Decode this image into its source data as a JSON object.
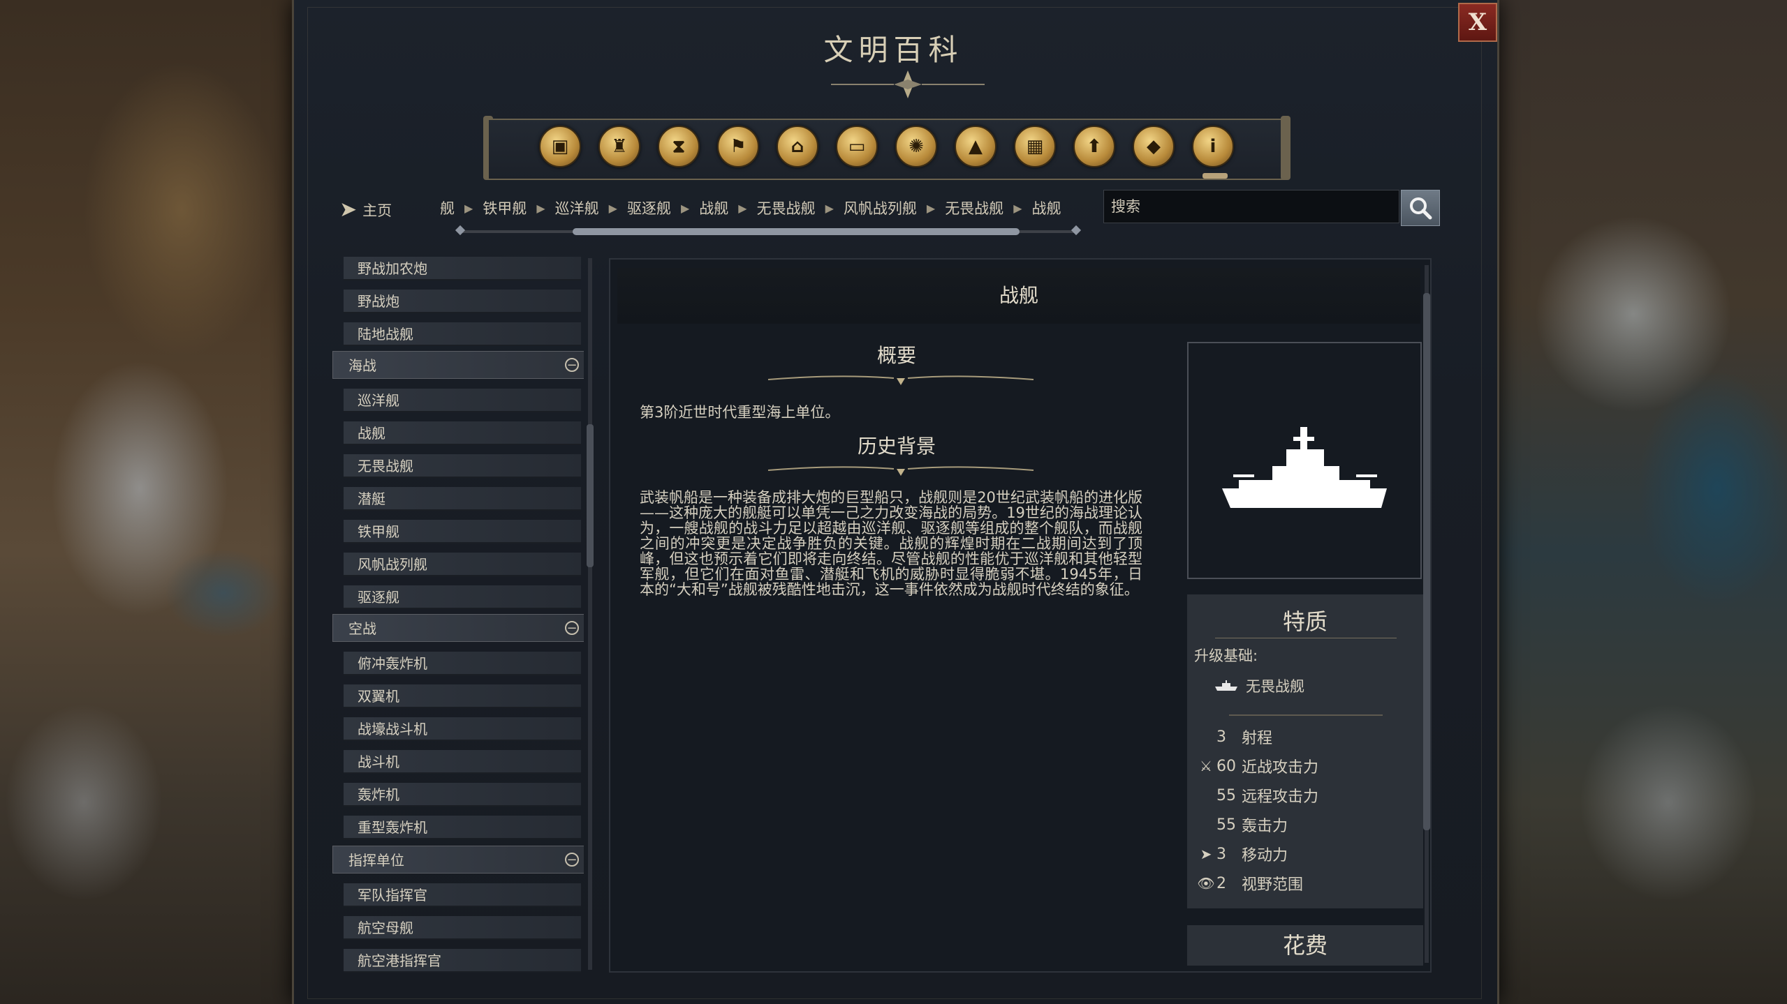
{
  "window": {
    "title": "文明百科",
    "close_label": "X"
  },
  "categories": [
    {
      "icon": "units-icon"
    },
    {
      "icon": "cup-icon"
    },
    {
      "icon": "hourglass-icon"
    },
    {
      "icon": "flag-icon"
    },
    {
      "icon": "building-icon"
    },
    {
      "icon": "book-icon"
    },
    {
      "icon": "atom-icon"
    },
    {
      "icon": "terrain-icon"
    },
    {
      "icon": "city-icon"
    },
    {
      "icon": "upgrade-icon"
    },
    {
      "icon": "resource-icon"
    },
    {
      "icon": "info-icon"
    }
  ],
  "breadcrumb": {
    "home": "主页",
    "items": [
      "舰",
      "铁甲舰",
      "巡洋舰",
      "驱逐舰",
      "战舰",
      "无畏战舰",
      "风帆战列舰",
      "无畏战舰",
      "战舰"
    ]
  },
  "search": {
    "placeholder": "搜索"
  },
  "sidebar": {
    "rows": [
      {
        "type": "item",
        "label": "野战加农炮"
      },
      {
        "type": "item",
        "label": "野战炮"
      },
      {
        "type": "item",
        "label": "陆地战舰"
      },
      {
        "type": "group",
        "label": "海战"
      },
      {
        "type": "item",
        "label": "巡洋舰"
      },
      {
        "type": "item",
        "label": "战舰"
      },
      {
        "type": "item",
        "label": "无畏战舰"
      },
      {
        "type": "item",
        "label": "潜艇"
      },
      {
        "type": "item",
        "label": "铁甲舰"
      },
      {
        "type": "item",
        "label": "风帆战列舰"
      },
      {
        "type": "item",
        "label": "驱逐舰"
      },
      {
        "type": "group",
        "label": "空战"
      },
      {
        "type": "item",
        "label": "俯冲轰炸机"
      },
      {
        "type": "item",
        "label": "双翼机"
      },
      {
        "type": "item",
        "label": "战壕战斗机"
      },
      {
        "type": "item",
        "label": "战斗机"
      },
      {
        "type": "item",
        "label": "轰炸机"
      },
      {
        "type": "item",
        "label": "重型轰炸机"
      },
      {
        "type": "group",
        "label": "指挥单位"
      },
      {
        "type": "item",
        "label": "军队指挥官"
      },
      {
        "type": "item",
        "label": "航空母舰"
      },
      {
        "type": "item",
        "label": "航空港指挥官"
      }
    ]
  },
  "article": {
    "title": "战舰",
    "summary_title": "概要",
    "summary": "第3阶近世时代重型海上单位。",
    "history_title": "历史背景",
    "history": "武装帆船是一种装备成排大炮的巨型船只，战舰则是20世纪武装帆船的进化版——这种庞大的舰艇可以单凭一己之力改变海战的局势。19世纪的海战理论认为，一艘战舰的战斗力足以超越由巡洋舰、驱逐舰等组成的整个舰队，而战舰之间的冲突更是决定战争胜负的关键。战舰的辉煌时期在二战期间达到了顶峰，但这也预示着它们即将走向终结。尽管战舰的性能优于巡洋舰和其他轻型军舰，但它们在面对鱼雷、潜艇和飞机的威胁时显得脆弱不堪。1945年，日本的“大和号”战舰被残酷性地击沉，这一事件依然成为战舰时代终结的象征。"
  },
  "traits": {
    "title": "特质",
    "upgrade_label": "升级基础:",
    "upgrade_from": "无畏战舰",
    "stats": [
      {
        "icon": "",
        "value": "3",
        "label": "射程"
      },
      {
        "icon": "melee-icon",
        "value": "60",
        "label": "近战攻击力"
      },
      {
        "icon": "",
        "value": "55",
        "label": "远程攻击力"
      },
      {
        "icon": "",
        "value": "55",
        "label": "轰击力"
      },
      {
        "icon": "movement-icon",
        "value": "3",
        "label": "移动力"
      },
      {
        "icon": "sight-icon",
        "value": "2",
        "label": "视野范围"
      }
    ]
  },
  "cost": {
    "title": "花费"
  }
}
